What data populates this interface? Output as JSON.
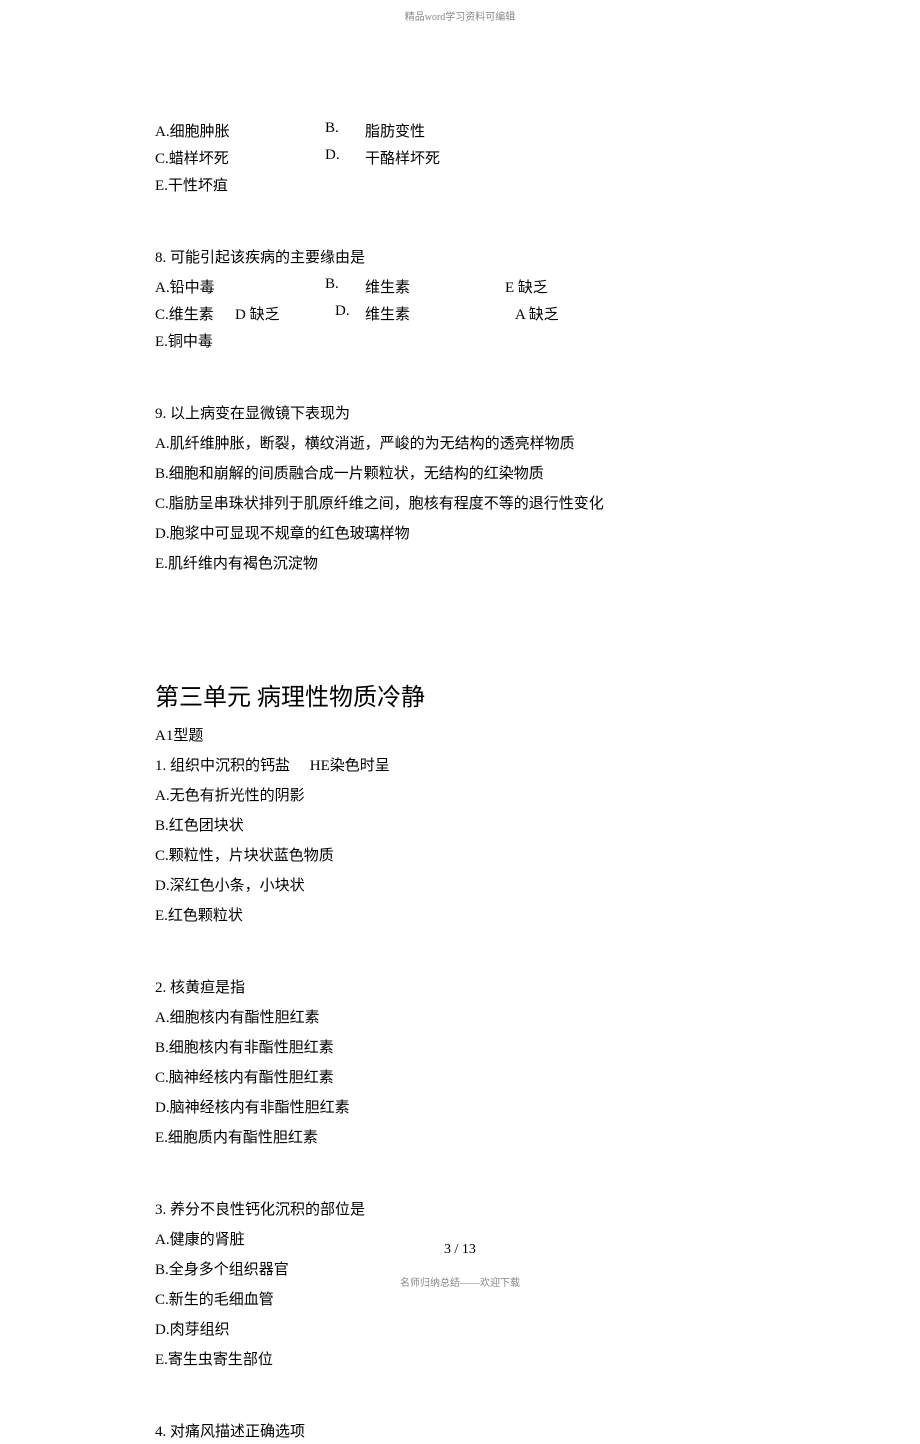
{
  "header_note": "精品word学习资料可编辑",
  "q_prev_options": {
    "A": "A.细胞肿胀",
    "B_label": "B.",
    "B_text": "脂肪变性",
    "C": "C.蜡样坏死",
    "D_label": "D.",
    "D_text": "干酪样坏死",
    "E": "E.干性坏疽"
  },
  "q8": {
    "stem": "8. 可能引起该疾病的主要缘由是",
    "A": "A.铅中毒",
    "B_label": "B.",
    "B_text1": "维生素",
    "B_text2": "E 缺乏",
    "C": "C.维生素",
    "C_mid": "D 缺乏",
    "D_label": "D.",
    "D_text1": "维生素",
    "D_text2": "A 缺乏",
    "E": "E.铜中毒"
  },
  "q9": {
    "stem": "9. 以上病变在显微镜下表现为",
    "A": "A.肌纤维肿胀，断裂，横纹消逝，严峻的为无结构的透亮样物质",
    "B": "B.细胞和崩解的间质融合成一片颗粒状，无结构的红染物质",
    "C": "C.脂肪呈串珠状排列于肌原纤维之间，胞核有程度不等的退行性变化",
    "D": "D.胞浆中可显现不规章的红色玻璃样物",
    "E": "E.肌纤维内有褐色沉淀物"
  },
  "unit3_heading": "第三单元  病理性物质冷静",
  "a1_label": "A1型题",
  "u3q1": {
    "stem_a": "1. 组织中沉积的钙盐",
    "stem_b": "HE染色时呈",
    "A": "A.无色有折光性的阴影",
    "B": "B.红色团块状",
    "C": "C.颗粒性，片块状蓝色物质",
    "D": "D.深红色小条，小块状",
    "E": "E.红色颗粒状"
  },
  "u3q2": {
    "stem": "2. 核黄疸是指",
    "A": "A.细胞核内有酯性胆红素",
    "B": "B.细胞核内有非酯性胆红素",
    "C": "C.脑神经核内有酯性胆红素",
    "D": "D.脑神经核内有非酯性胆红素",
    "E": "E.细胞质内有酯性胆红素"
  },
  "u3q3": {
    "stem": "3. 养分不良性钙化沉积的部位是",
    "A": "A.健康的肾脏",
    "B": "B.全身多个组织器官",
    "C": "C.新生的毛细血管",
    "D": "D.肉芽组织",
    "E": "E.寄生虫寄生部位"
  },
  "u3q4": {
    "stem": "4. 对痛风描述正确选项"
  },
  "page_num": "3 / 13",
  "footer_note": "名师归纳总结——欢迎下载"
}
